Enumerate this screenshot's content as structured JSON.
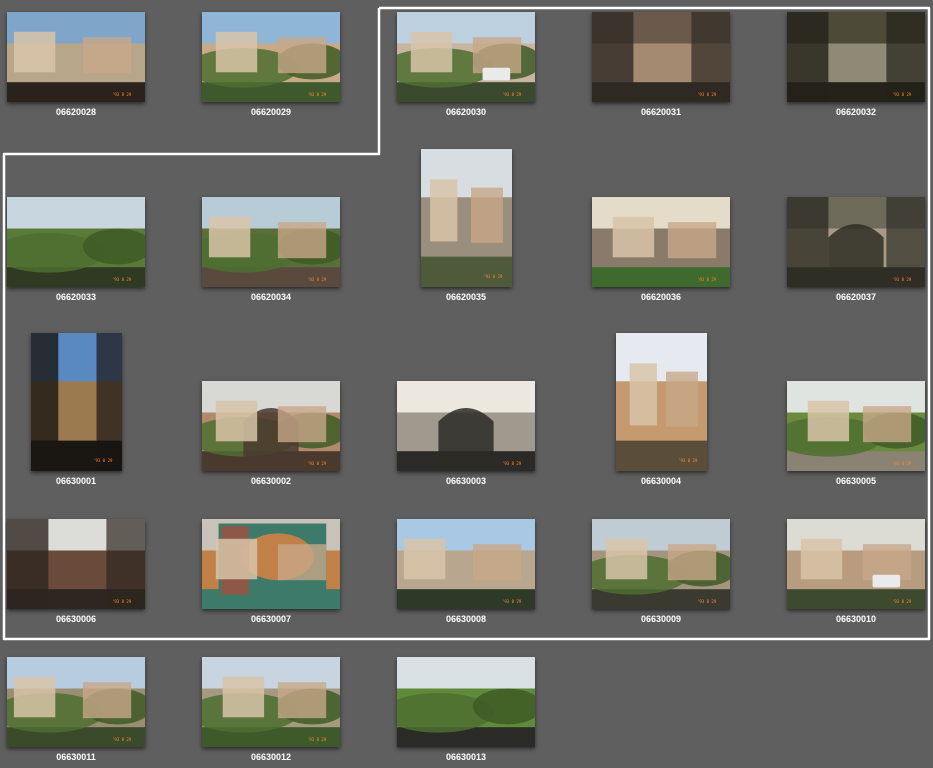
{
  "photos": [
    {
      "name": "06620028",
      "scene": "coastal-apartments",
      "orientation": "landscape",
      "palette": [
        "#7fa6c8",
        "#b8a68a",
        "#2a221c"
      ],
      "stamp": "'93 8 29"
    },
    {
      "name": "06620029",
      "scene": "village-square-cypress",
      "orientation": "landscape",
      "palette": [
        "#8fb6d6",
        "#c8a988",
        "#3e5a2c"
      ],
      "stamp": "'93 8 29"
    },
    {
      "name": "06620030",
      "scene": "street-with-cars",
      "orientation": "landscape",
      "palette": [
        "#bcd0e0",
        "#c9b4a0",
        "#3b4a2e"
      ],
      "stamp": "'93 8 29"
    },
    {
      "name": "06620031",
      "scene": "narrow-alley",
      "orientation": "landscape",
      "palette": [
        "#6b5a4c",
        "#a58a72",
        "#2f2924"
      ],
      "stamp": "'93 8 29"
    },
    {
      "name": "06620032",
      "scene": "stone-passage",
      "orientation": "landscape",
      "palette": [
        "#4e4a38",
        "#8e8a76",
        "#24221a"
      ],
      "stamp": "'93 8 29"
    },
    {
      "name": "06620033",
      "scene": "green-hillside",
      "orientation": "landscape",
      "palette": [
        "#c8d6e0",
        "#5a7a3a",
        "#2e3a22"
      ],
      "stamp": "'93 8 29"
    },
    {
      "name": "06620034",
      "scene": "hill-rooftop",
      "orientation": "landscape",
      "palette": [
        "#b8ccd8",
        "#5a6e3a",
        "#5a4a3e"
      ],
      "stamp": "'93 8 29"
    },
    {
      "name": "06620035",
      "scene": "stone-wall-steps",
      "orientation": "portrait",
      "palette": [
        "#d8dde2",
        "#9a8e7c",
        "#4e5a3a"
      ],
      "stamp": "'93 8 29"
    },
    {
      "name": "06620036",
      "scene": "flower-lane",
      "orientation": "landscape",
      "palette": [
        "#e4dcc8",
        "#8a7a6a",
        "#3f6a2e"
      ],
      "stamp": "'93 8 29"
    },
    {
      "name": "06620037",
      "scene": "arched-stairway",
      "orientation": "landscape",
      "palette": [
        "#6e6a5a",
        "#a89a84",
        "#2f2e26"
      ],
      "stamp": "'93 8 29"
    },
    {
      "name": "06630001",
      "scene": "clock-tower",
      "orientation": "portrait",
      "palette": [
        "#5a88c0",
        "#9c7a50",
        "#1a1612"
      ],
      "stamp": "'93 8 29"
    },
    {
      "name": "06630002",
      "scene": "arcade-street",
      "orientation": "landscape",
      "palette": [
        "#d8d8d4",
        "#b08a6a",
        "#4a3a2e"
      ],
      "stamp": "'93 8 29"
    },
    {
      "name": "06630003",
      "scene": "stone-archway",
      "orientation": "landscape",
      "palette": [
        "#ece8e0",
        "#a0998e",
        "#2c2a26"
      ],
      "stamp": "'93 8 29"
    },
    {
      "name": "06630004",
      "scene": "ochre-house",
      "orientation": "portrait",
      "palette": [
        "#e6eaf0",
        "#c49a6e",
        "#5a4e3a"
      ],
      "stamp": "'93 8 29"
    },
    {
      "name": "06630005",
      "scene": "plane-trees",
      "orientation": "landscape",
      "palette": [
        "#e0e4e0",
        "#6a8a3e",
        "#8a8272"
      ],
      "stamp": "'93 8 29"
    },
    {
      "name": "06630006",
      "scene": "old-barn",
      "orientation": "landscape",
      "palette": [
        "#dcdcd8",
        "#6a4a3a",
        "#2e2620"
      ],
      "stamp": "'93 8 29"
    },
    {
      "name": "06630007",
      "scene": "village-map-sign",
      "orientation": "landscape",
      "palette": [
        "#c8c2b8",
        "#c08048",
        "#3e7a6a"
      ],
      "stamp": ""
    },
    {
      "name": "06630008",
      "scene": "sunny-square",
      "orientation": "landscape",
      "palette": [
        "#a8c8e4",
        "#b8a68e",
        "#2e3a28"
      ],
      "stamp": "'93 8 29"
    },
    {
      "name": "06630009",
      "scene": "market-street",
      "orientation": "landscape",
      "palette": [
        "#c0ccd4",
        "#a4967e",
        "#3a3a30"
      ],
      "stamp": "'93 8 29"
    },
    {
      "name": "06630010",
      "scene": "village-road-car",
      "orientation": "landscape",
      "palette": [
        "#dcdcd4",
        "#b89c80",
        "#3e4a30"
      ],
      "stamp": "'93 8 29"
    },
    {
      "name": "06630011",
      "scene": "hilltop-village",
      "orientation": "landscape",
      "palette": [
        "#b8cce0",
        "#9a8e72",
        "#3a4a2a"
      ],
      "stamp": "'93 8 29"
    },
    {
      "name": "06630012",
      "scene": "village-with-tree",
      "orientation": "landscape",
      "palette": [
        "#c8d4e0",
        "#a49a80",
        "#3e5a2a"
      ],
      "stamp": "'93 8 29"
    },
    {
      "name": "06630013",
      "scene": "field-trees",
      "orientation": "landscape",
      "palette": [
        "#d8e0e4",
        "#5e8a3a",
        "#2a2a26"
      ],
      "stamp": ""
    }
  ],
  "selection_color": "#ffffff"
}
